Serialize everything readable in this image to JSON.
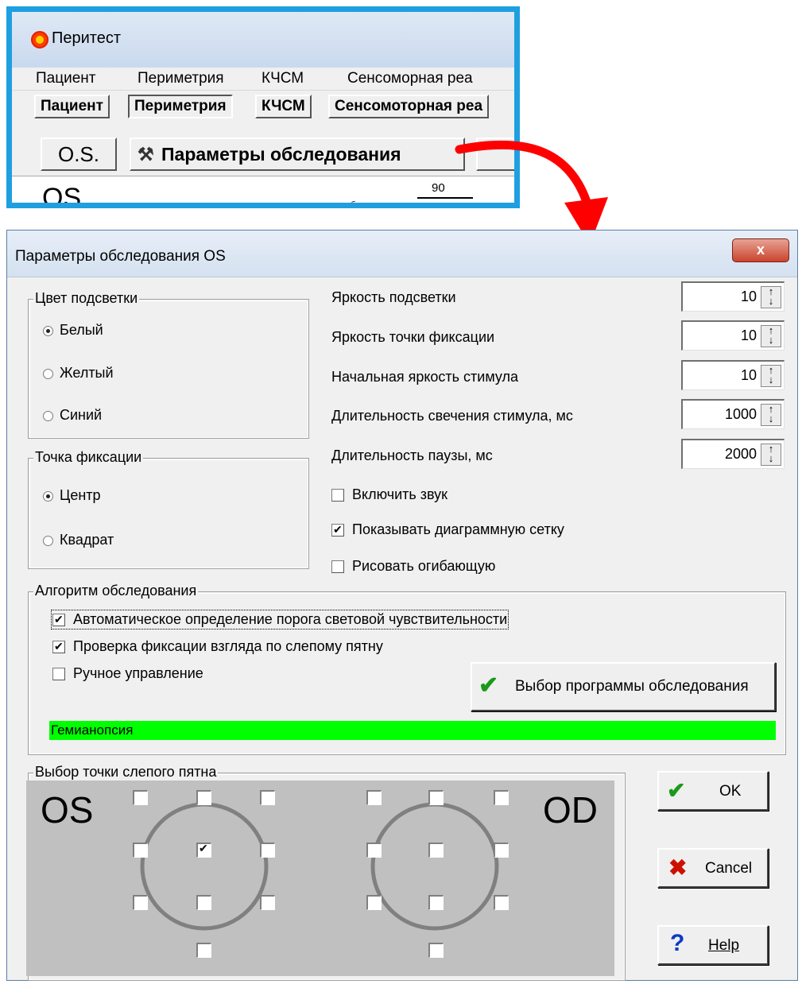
{
  "inset": {
    "app_title": "Перитест",
    "menu": [
      "Пациент",
      "Периметрия",
      "КЧСМ",
      "Сенсоморная реа"
    ],
    "tabs": [
      "Пациент",
      "Периметрия",
      "КЧСМ",
      "Сенсомоторная реа"
    ],
    "active_tab": "Периметрия",
    "os_button": "O.S.",
    "params_button": "Параметры обследования",
    "content_label": "OS",
    "content_number": "90",
    "content_small": "об"
  },
  "dialog": {
    "title": "Параметры обследования OS",
    "close_label": "x",
    "color_group": {
      "title": "Цвет подсветки",
      "options": [
        "Белый",
        "Желтый",
        "Синий"
      ],
      "selected": "Белый"
    },
    "fixation_group": {
      "title": "Точка фиксации",
      "options": [
        "Центр",
        "Квадрат"
      ],
      "selected": "Центр"
    },
    "params": [
      {
        "label": "Яркость подсветки",
        "value": "10"
      },
      {
        "label": "Яркость точки фиксации",
        "value": "10"
      },
      {
        "label": "Начальная яркость стимула",
        "value": "10"
      },
      {
        "label": "Длительность свечения стимула, мс",
        "value": "1000"
      },
      {
        "label": "Длительность паузы, мс",
        "value": "2000"
      }
    ],
    "options": [
      {
        "label": "Включить звук",
        "checked": false
      },
      {
        "label": "Показывать диаграммную сетку",
        "checked": true
      },
      {
        "label": "Рисовать огибающую",
        "checked": false
      }
    ],
    "algorithm_group": {
      "title": "Алгоритм обследования",
      "items": [
        {
          "label": "Автоматическое определение порога световой чувствительности",
          "checked": true
        },
        {
          "label": "Проверка фиксации взгляда по слепому пятну",
          "checked": true
        },
        {
          "label": "Ручное управление",
          "checked": false
        }
      ],
      "program_button": "Выбор программы обследования",
      "program_name": "Гемианопсия",
      "program_color": "#00ff00"
    },
    "blindspot_group": {
      "title": "Выбор точки слепого пятна",
      "left_label": "OS",
      "right_label": "OD"
    },
    "buttons": {
      "ok": "OK",
      "cancel": "Cancel",
      "help": "Help"
    }
  },
  "colors": {
    "inset_border": "#1e9fe0",
    "arrow": "#ff0000",
    "panel_gray": "#c0c0c0",
    "program_bar": "#00ff00"
  }
}
